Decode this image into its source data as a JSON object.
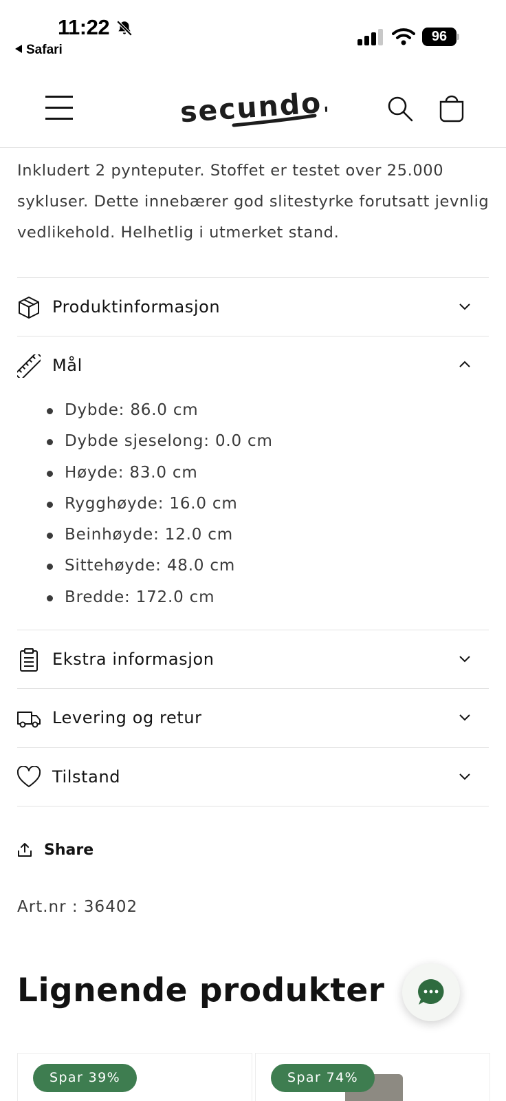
{
  "status_bar": {
    "time": "11:22",
    "back_app": "Safari",
    "battery": "96",
    "icons": [
      "bell-slash-icon",
      "signal-icon",
      "wifi-icon",
      "battery-icon"
    ]
  },
  "header": {
    "logo": "secundo.",
    "icons": [
      "menu-icon",
      "search-icon",
      "cart-icon"
    ]
  },
  "description": "Inkludert 2 pynteputer. Stoffet er testet over 25.000 sykluser. Dette innebærer god slitestyrke forutsatt jevnlig vedlikehold. Helhetlig i utmerket stand.",
  "accordion": [
    {
      "label": "Produktinformasjon",
      "icon": "box-icon",
      "expanded": false
    },
    {
      "label": "Mål",
      "icon": "ruler-icon",
      "expanded": true
    },
    {
      "label": "Ekstra informasjon",
      "icon": "clipboard-icon",
      "expanded": false
    },
    {
      "label": "Levering og retur",
      "icon": "truck-icon",
      "expanded": false
    },
    {
      "label": "Tilstand",
      "icon": "heart-icon",
      "expanded": false
    }
  ],
  "dimensions": [
    "Dybde: 86.0 cm",
    "Dybde sjeselong: 0.0 cm",
    "Høyde: 83.0 cm",
    "Rygghøyde: 16.0 cm",
    "Beinhøyde: 12.0 cm",
    "Sittehøyde: 48.0 cm",
    "Bredde: 172.0 cm"
  ],
  "share_label": "Share",
  "article_number": "Art.nr : 36402",
  "related_title": "Lignende produkter",
  "related_products": [
    {
      "badge": "Spar 39%"
    },
    {
      "badge": "Spar 74%"
    }
  ],
  "colors": {
    "badge_green": "#3e7d50",
    "chat_green": "#2f6b3f",
    "text": "#121212",
    "muted_text": "#3a3a3a",
    "divider": "#e2e2e2"
  }
}
